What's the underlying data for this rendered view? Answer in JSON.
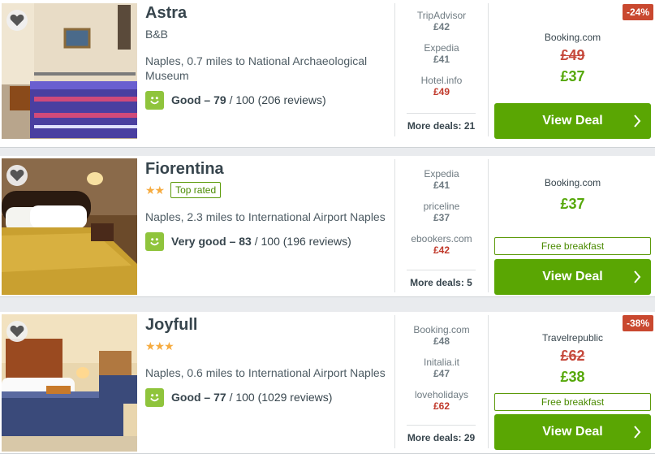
{
  "hotels": [
    {
      "name": "Astra",
      "type": "B&B",
      "stars": "",
      "top_rated": "",
      "location": "Naples, 0.7 miles to National Archaeological Museum",
      "rating_label": "Good – 79",
      "rating_rest": " / 100 (206 reviews)",
      "deals": [
        {
          "site": "TripAdvisor",
          "price": "£42"
        },
        {
          "site": "Expedia",
          "price": "£41"
        },
        {
          "site": "Hotel.info",
          "price": "£49"
        }
      ],
      "more_deals": "More deals: 21",
      "offer": {
        "site": "Booking.com",
        "old_price": "£49",
        "price": "£37",
        "discount": "-24%",
        "breakfast": ""
      },
      "view_deal": "View Deal"
    },
    {
      "name": "Fiorentina",
      "type": "",
      "stars": "★★",
      "top_rated": "Top rated",
      "location": "Naples, 2.3 miles to International Airport Naples",
      "rating_label": "Very good – 83",
      "rating_rest": " / 100 (196 reviews)",
      "deals": [
        {
          "site": "Expedia",
          "price": "£41"
        },
        {
          "site": "priceline",
          "price": "£37"
        },
        {
          "site": "ebookers.com",
          "price": "£42"
        }
      ],
      "more_deals": "More deals: 5",
      "offer": {
        "site": "Booking.com",
        "old_price": "",
        "price": "£37",
        "discount": "",
        "breakfast": "Free breakfast"
      },
      "view_deal": "View Deal"
    },
    {
      "name": "Joyfull",
      "type": "",
      "stars": "★★★",
      "top_rated": "",
      "location": "Naples, 0.6 miles to International Airport Naples",
      "rating_label": "Good – 77",
      "rating_rest": " / 100 (1029 reviews)",
      "deals": [
        {
          "site": "Booking.com",
          "price": "£48"
        },
        {
          "site": "Initalia.it",
          "price": "£47"
        },
        {
          "site": "loveholidays",
          "price": "£62"
        }
      ],
      "more_deals": "More deals: 29",
      "offer": {
        "site": "Travelrepublic",
        "old_price": "£62",
        "price": "£38",
        "discount": "-38%",
        "breakfast": "Free breakfast"
      },
      "view_deal": "View Deal"
    }
  ],
  "colors": {
    "accent_green": "#5aa603",
    "price_green": "#56a80a",
    "price_red": "#c6493c",
    "discount_bg": "#c9482f",
    "star": "#f6ab3f",
    "rating_badge": "#8fc43c"
  },
  "icons": {
    "favorite": "heart-icon",
    "rating": "smiley-icon",
    "cta": "chevron-right-icon"
  }
}
